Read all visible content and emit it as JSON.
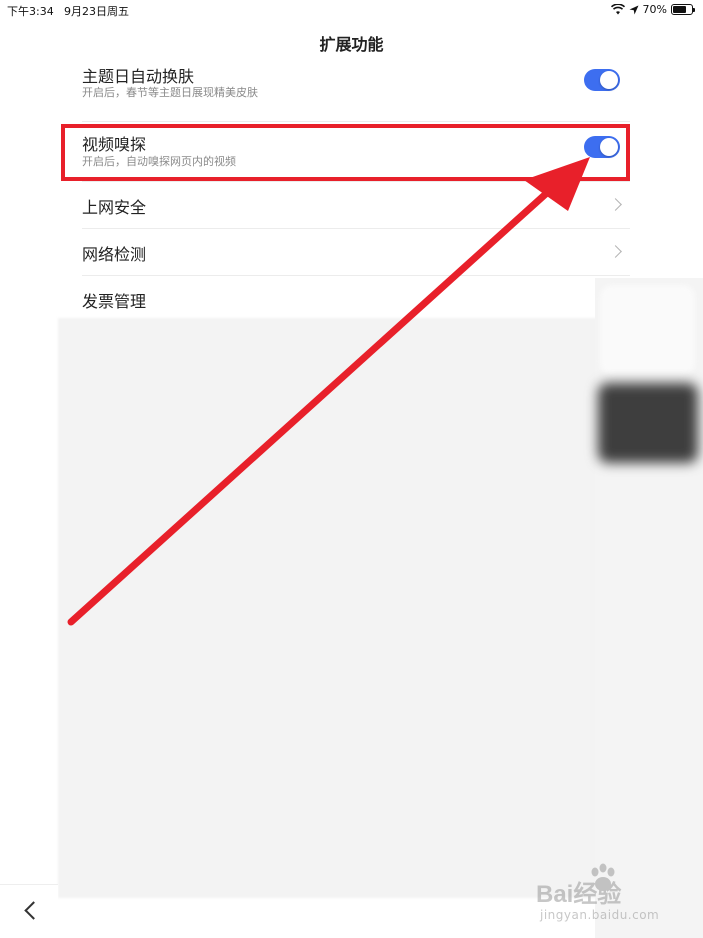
{
  "status": {
    "time": "下午3:34",
    "date": "9月23日周五",
    "battery": "70%",
    "battery_level": 0.7
  },
  "nav": {
    "title": "扩展功能",
    "back_icon": "chevron-left-icon"
  },
  "rows": [
    {
      "title": "主题日自动换肤",
      "subtitle": "开启后，春节等主题日展现精美皮肤",
      "toggle_on": true
    },
    {
      "title": "视频嗅探",
      "subtitle": "开启后，自动嗅探网页内的视频",
      "toggle_on": true
    },
    {
      "title": "上网安全"
    },
    {
      "title": "网络检测"
    },
    {
      "title": "发票管理"
    }
  ],
  "annotation": {
    "color": "#e8202a"
  },
  "accent": "#3d6ef0",
  "watermark": {
    "brand": "Bai经验",
    "url": "jingyan.baidu.com"
  }
}
